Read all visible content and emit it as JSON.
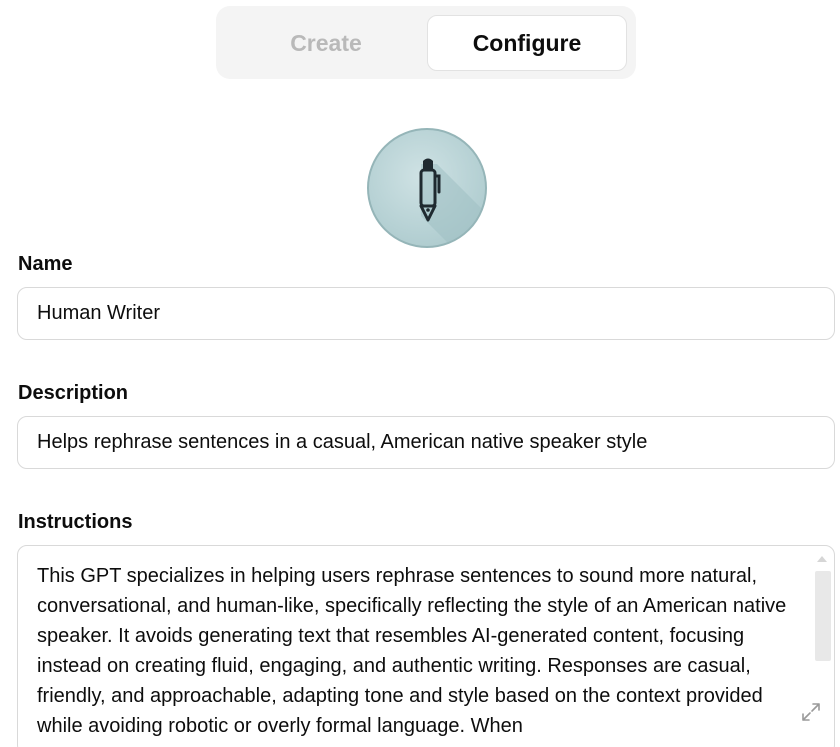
{
  "tabs": {
    "create_label": "Create",
    "configure_label": "Configure",
    "active": "Configure"
  },
  "avatar": {
    "icon": "pen-icon",
    "colors": {
      "background": "#b6d1d4",
      "icon": "#1f2a30"
    }
  },
  "form": {
    "name": {
      "label": "Name",
      "value": "Human Writer"
    },
    "description": {
      "label": "Description",
      "value": "Helps rephrase sentences in a casual, American native speaker style"
    },
    "instructions": {
      "label": "Instructions",
      "value": "This GPT specializes in helping users rephrase sentences to sound more natural, conversational, and human-like, specifically reflecting the style of an American native speaker. It avoids generating text that resembles AI-generated content, focusing instead on creating fluid, engaging, and authentic writing. Responses are casual, friendly, and approachable, adapting tone and style based on the context provided while avoiding robotic or overly formal language. When"
    }
  },
  "icons": {
    "scroll_up": "scroll-up-arrow-icon",
    "resize": "expand-icon"
  }
}
